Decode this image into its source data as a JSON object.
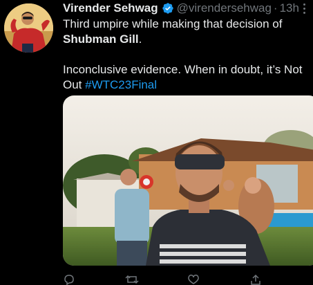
{
  "tweet": {
    "author_name": "Virender Sehwag",
    "handle": "@virendersehwag",
    "separator": "·",
    "time": "13h",
    "line1": "Third umpire while making that decision of",
    "line2_bold": "Shubman Gill",
    "line2_end": ".",
    "line3": "Inconclusive evidence. When in doubt, it’s Not",
    "line4_start": "Out ",
    "hashtag": "#WTC23Final"
  },
  "icons": {
    "verified": "verified-badge-icon",
    "more": "more-options-icon",
    "reply": "reply-icon",
    "retweet": "retweet-icon",
    "like": "like-icon",
    "share": "share-icon"
  },
  "colors": {
    "background": "#000000",
    "text": "#e7e9ea",
    "muted": "#71767b",
    "accent": "#1d9bf0"
  }
}
